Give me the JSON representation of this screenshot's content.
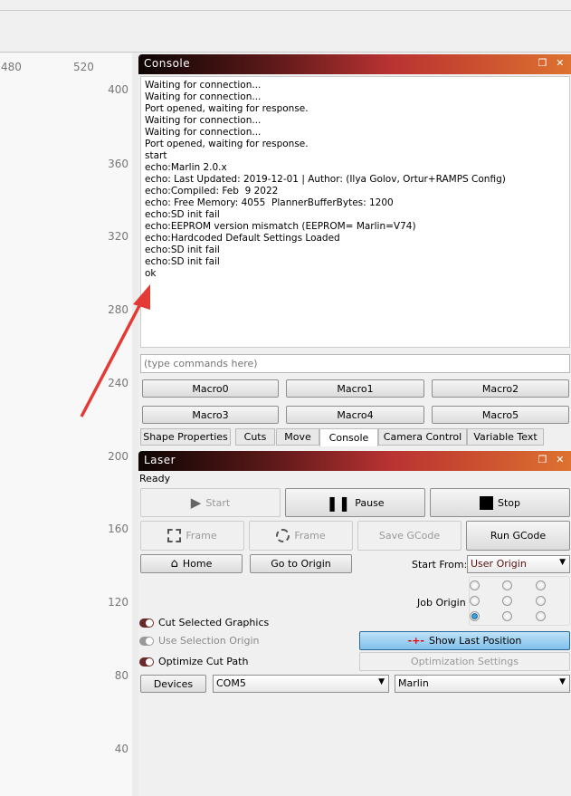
{
  "ruler": {
    "x_labels": [
      "480",
      "520"
    ],
    "y_labels": [
      "400",
      "360",
      "320",
      "280",
      "240",
      "200",
      "160",
      "120",
      "80",
      "40"
    ]
  },
  "console": {
    "title": "Console",
    "lines": [
      "Waiting for connection...",
      "Waiting for connection...",
      "Port opened, waiting for response.",
      "Waiting for connection...",
      "Waiting for connection...",
      "Port opened, waiting for response.",
      "start",
      "echo:Marlin 2.0.x",
      "echo: Last Updated: 2019-12-01 | Author: (Ilya Golov, Ortur+RAMPS Config)",
      "echo:Compiled: Feb  9 2022",
      "echo: Free Memory: 4055  PlannerBufferBytes: 1200",
      "echo:SD init fail",
      "echo:EEPROM version mismatch (EEPROM= Marlin=V74)",
      "echo:Hardcoded Default Settings Loaded",
      "echo:SD init fail",
      "echo:SD init fail",
      "ok"
    ],
    "input_placeholder": "(type commands here)",
    "macros": [
      "Macro0",
      "Macro1",
      "Macro2",
      "Macro3",
      "Macro4",
      "Macro5"
    ]
  },
  "tabs": [
    "Shape Properties",
    "Cuts",
    "Move",
    "Console",
    "Camera Control",
    "Variable Text"
  ],
  "active_tab": "Console",
  "laser": {
    "title": "Laser",
    "status": "Ready",
    "start": "Start",
    "pause": "Pause",
    "stop": "Stop",
    "frame_rect": "Frame",
    "frame_circle": "Frame",
    "save_gcode": "Save GCode",
    "run_gcode": "Run GCode",
    "home": "Home",
    "go_to_origin": "Go to Origin",
    "start_from_label": "Start From:",
    "start_from_value": "User Origin",
    "job_origin_label": "Job Origin",
    "job_origin_selected": "bottom-left",
    "cut_selected": "Cut Selected Graphics",
    "use_selection_origin": "Use Selection Origin",
    "optimize_cut_path": "Optimize Cut Path",
    "show_last_position": "Show Last Position",
    "optimization_settings": "Optimization Settings",
    "devices": "Devices",
    "port": "COM5",
    "firmware": "Marlin"
  },
  "colors": {
    "accent_red": "#b83232",
    "arrow": "#e53935",
    "toggle_on": "#6b2a2a"
  }
}
